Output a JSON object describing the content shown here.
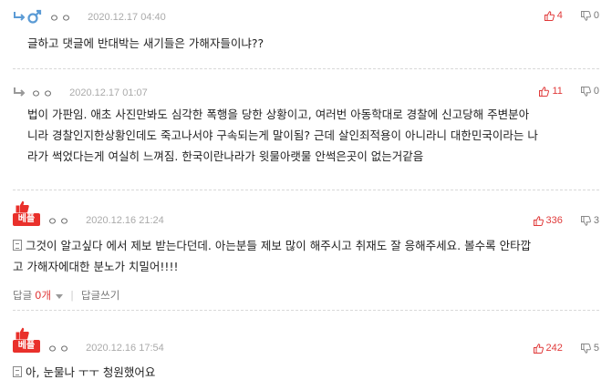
{
  "colors": {
    "accent": "#e03a3a",
    "best_badge": "#e9302b",
    "male_icon": "#5b9bd5"
  },
  "comments": [
    {
      "nick": "ㅇㅇ",
      "date": "2020.12.17 04:40",
      "up": "4",
      "down": "0",
      "body": "글하고 댓글에 반대박는 새기들은 가해자들이냐??"
    },
    {
      "nick": "ㅇㅇ",
      "date": "2020.12.17 01:07",
      "up": "11",
      "down": "0",
      "body": [
        "법이 가판임. 애초 사진만봐도 심각한 폭행을 당한 상황이고, 여러번 아동학대로 경찰에 신고당해 주변분아",
        "니라 경찰인지한상황인데도 죽고나서야 구속되는게 말이됨? 근데 살인죄적용이 아니라니 대한민국이라는 나",
        "라가 썩었다는게 여실히 느껴짐. 한국이란나라가 윗물아랫물 안썩은곳이 없는거같음"
      ]
    },
    {
      "badge": "베플",
      "nick": "ㅇㅇ",
      "date": "2020.12.16 21:24",
      "up": "336",
      "down": "3",
      "body": [
        "그것이 알고싶다 에서 제보 받는다던데. 아는분들 제보 많이 해주시고 취재도 잘 응해주세요. 볼수록 안타깝",
        "고 가해자에대한 분노가 치밀어!!!!"
      ],
      "reply_label": "답글",
      "reply_count": "0개",
      "write_reply": "답글쓰기"
    },
    {
      "badge": "베플",
      "nick": "ㅇㅇ",
      "date": "2020.12.16 17:54",
      "up": "242",
      "down": "5",
      "body": "아, 눈물나 ㅜㅜ 청원했어요"
    }
  ]
}
